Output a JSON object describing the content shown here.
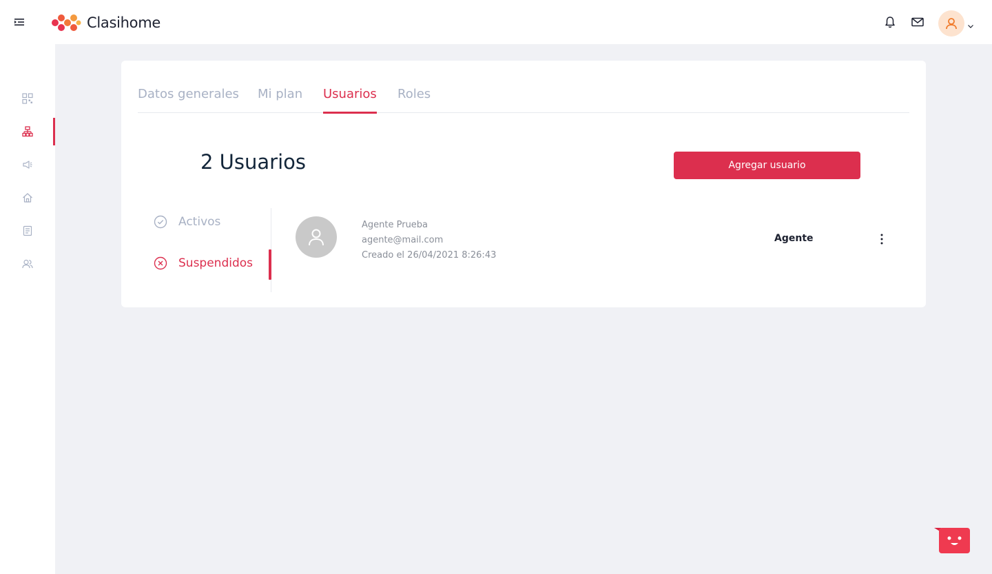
{
  "app": {
    "name": "Clasihome"
  },
  "colors": {
    "accent": "#dc2f4e",
    "muted": "#a8b1c4",
    "avatar_bg": "#fde3cf"
  },
  "header": {
    "icons": [
      "menu-toggle-icon",
      "bell-icon",
      "mail-icon",
      "user-icon",
      "chevron-down-icon"
    ]
  },
  "sidebar": {
    "items": [
      {
        "icon": "qr-grid-icon",
        "active": false
      },
      {
        "icon": "sitemap-icon",
        "active": true
      },
      {
        "icon": "megaphone-icon",
        "active": false
      },
      {
        "icon": "home-icon",
        "active": false
      },
      {
        "icon": "document-icon",
        "active": false
      },
      {
        "icon": "users-icon",
        "active": false
      }
    ]
  },
  "tabs": [
    {
      "label": "Datos generales",
      "active": false
    },
    {
      "label": "Mi plan",
      "active": false
    },
    {
      "label": "Usuarios",
      "active": true
    },
    {
      "label": "Roles",
      "active": false
    }
  ],
  "users_section": {
    "title": "2 Usuarios",
    "add_button": "Agregar usuario",
    "filters": {
      "activos": "Activos",
      "suspendidos": "Suspendidos"
    },
    "users": [
      {
        "name": "Agente Prueba",
        "email": "agente@mail.com",
        "created": "Creado el 26/04/2021 8:26:43",
        "role": "Agente"
      }
    ]
  }
}
